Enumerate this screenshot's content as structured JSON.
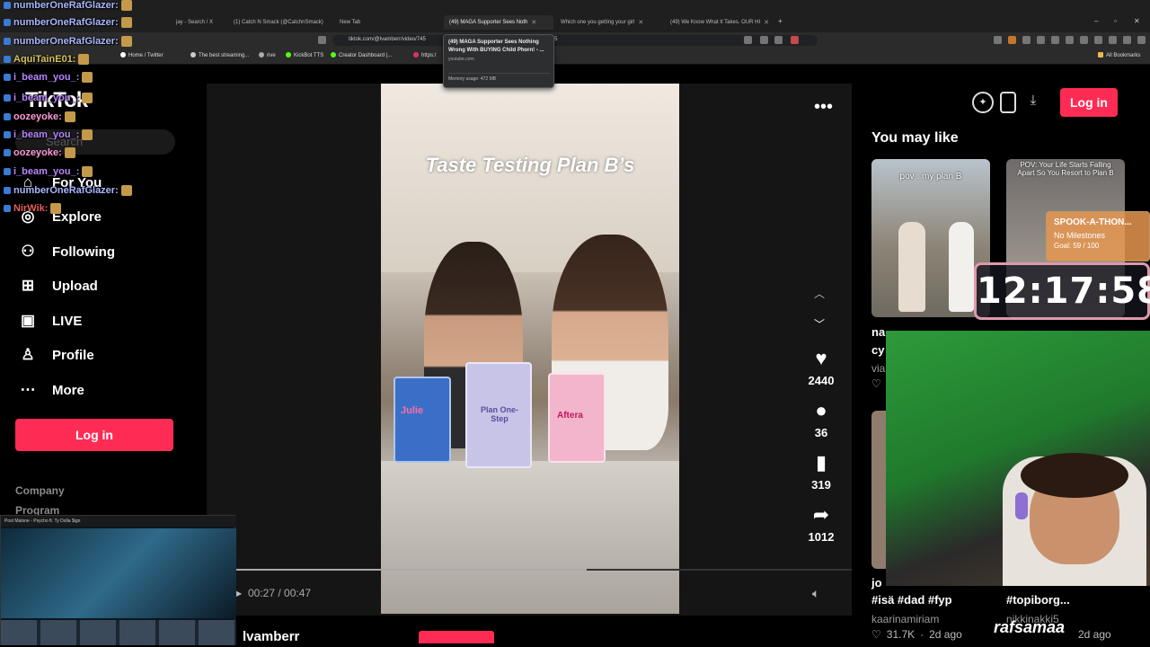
{
  "browser": {
    "tabs": [
      {
        "label": "jay - Search / X",
        "active": false
      },
      {
        "label": "(1) Catch N Smack (@CatchnSmack)",
        "active": false
      },
      {
        "label": "New Tab",
        "active": false
      },
      {
        "label": "(49) MAGA Supporter Sees Noth",
        "active": true
      },
      {
        "label": "Which one you getting your girl",
        "active": false
      },
      {
        "label": "(49) We Know What It Takes. OUR HI",
        "active": false
      }
    ],
    "url": "tiktok.com/@lvamberr/video/745",
    "url_tail": "WSnul5",
    "bookmarks": [
      "Home / Twitter",
      "The best streaming...",
      "rive",
      "KickBot TTS",
      "Creator Dashboard |...",
      "https:/"
    ],
    "all_bookmarks": "All Bookmarks",
    "tooltip": {
      "title": "(49) MAGA Supporter Sees Nothing Wrong With BUYING Child Phorn! - ...",
      "source": "youtube.com",
      "memory": "Memory usage: 472 MB"
    }
  },
  "sidebar": {
    "logo": "TikTok",
    "search_placeholder": "Search",
    "nav": [
      {
        "label": "For You",
        "icon": "home-icon"
      },
      {
        "label": "Explore",
        "icon": "compass-icon"
      },
      {
        "label": "Following",
        "icon": "following-icon"
      },
      {
        "label": "Upload",
        "icon": "upload-icon"
      },
      {
        "label": "LIVE",
        "icon": "live-icon"
      },
      {
        "label": "Profile",
        "icon": "profile-icon"
      },
      {
        "label": "More",
        "icon": "more-icon"
      }
    ],
    "login": "Log in",
    "footer": [
      "Company",
      "Program"
    ]
  },
  "chat": [
    {
      "user": "numberOneRafGlazer:",
      "color": "#a9b6ff"
    },
    {
      "user": "numberOneRafGlazer:",
      "color": "#a9b6ff"
    },
    {
      "user": "numberOneRafGlazer:",
      "color": "#a9b6ff"
    },
    {
      "user": "AquiTainE01:",
      "color": "#d4c35a"
    },
    {
      "user": "i_beam_you_:",
      "color": "#b784ff"
    },
    {
      "user": "i_beam_you_:",
      "color": "#b784ff"
    },
    {
      "user": "oozeyoke:",
      "color": "#ff9bd8"
    },
    {
      "user": "i_beam_you_:",
      "color": "#b784ff"
    },
    {
      "user": "oozeyoke:",
      "color": "#ff9bd8"
    },
    {
      "user": "i_beam_you_:",
      "color": "#b784ff"
    },
    {
      "user": "numberOneRafGlazer:",
      "color": "#a9b6ff"
    },
    {
      "user": "NirWik:",
      "color": "#e85c5c"
    }
  ],
  "video": {
    "title": "Taste Testing Plan B’s",
    "author": "lvamberr",
    "time": "00:27 / 00:47",
    "progress": 0.57,
    "actions": [
      {
        "name": "like",
        "icon": "heart-icon",
        "count": "2440"
      },
      {
        "name": "comment",
        "icon": "comment-icon",
        "count": "36"
      },
      {
        "name": "save",
        "icon": "bookmark-icon",
        "count": "319"
      },
      {
        "name": "share",
        "icon": "share-icon",
        "count": "1012"
      }
    ],
    "product_labels": [
      "Julie",
      "Plan One-Step",
      "Aftera"
    ]
  },
  "right": {
    "login": "Log in",
    "heading": "You may like",
    "thumbs": [
      {
        "caption": "pov : my plan B"
      },
      {
        "caption": "POV: Your Life Starts Falling Apart So You Resort to Plan B"
      }
    ],
    "snippets": {
      "left1": "na",
      "left2": "cy",
      "left3": "via"
    },
    "bottom": {
      "tags1": "#isä #dad #fyp",
      "tags2": "#topiborg...",
      "user1": "kaarinamiriam",
      "user2": "nikkinakki5",
      "likes1": "31.7K",
      "ago1": "2d ago",
      "ago2": "2d ago",
      "prefix1": "jo"
    }
  },
  "overlay": {
    "spook_title": "SPOOK-A-THON...",
    "spook_status": "No Milestones",
    "spook_goal": "Goal: 59 / 100",
    "timer": "12:17:58",
    "cam_name": "rafsamaa"
  },
  "mini_player": {
    "title": "Post Malone - Psycho ft. Ty Dolla $ign"
  }
}
